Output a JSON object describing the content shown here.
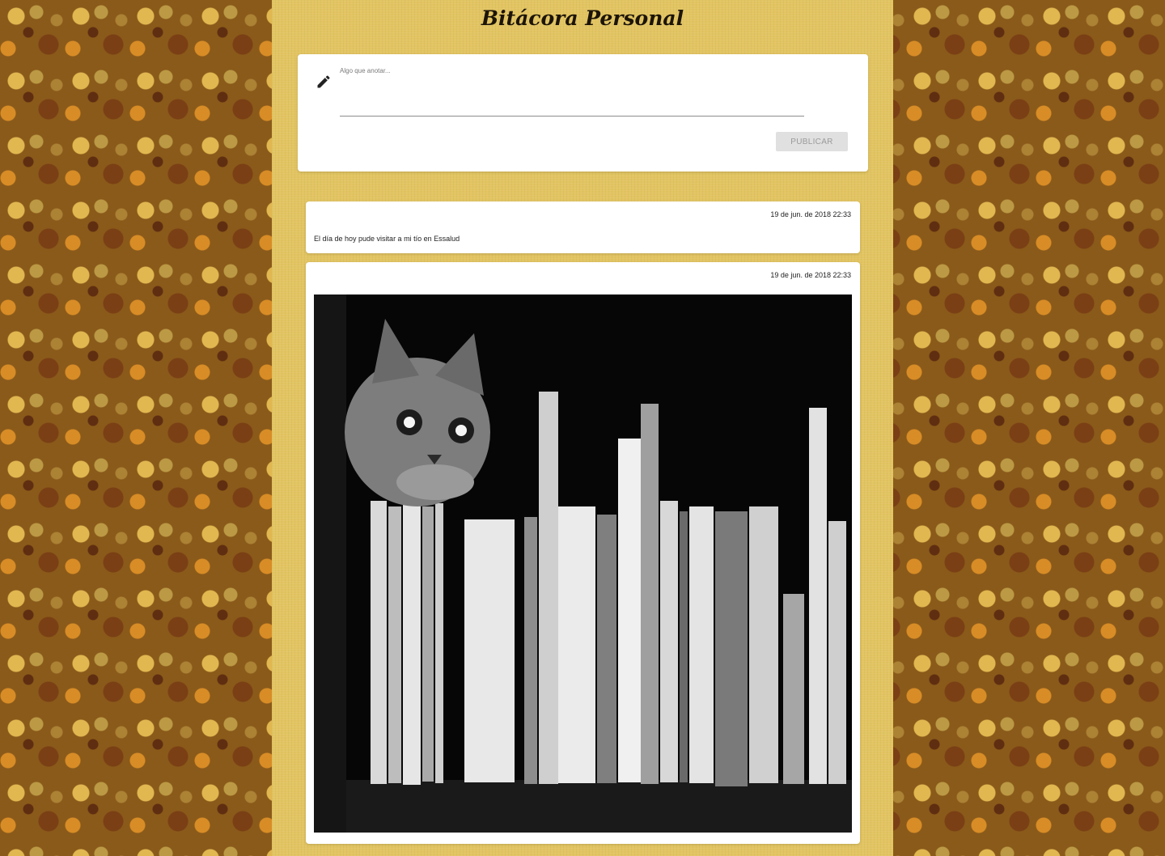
{
  "header": {
    "title": "Bitácora Personal"
  },
  "composer": {
    "label": "Algo que anotar...",
    "value": "",
    "publish_label": "PUBLICAR",
    "icon": "pencil-icon"
  },
  "posts": [
    {
      "date": "19 de jun. de 2018 22:33",
      "text": "El día de hoy pude visitar a mi tío en Essalud"
    },
    {
      "date": "19 de jun. de 2018 22:33",
      "image": "black-and-white photo of a kitten peeking over books on a shelf"
    }
  ],
  "colors": {
    "panel": "#e2c461",
    "card": "#ffffff",
    "button_bg": "#e0e0e0",
    "button_text": "#9a9a9a"
  }
}
